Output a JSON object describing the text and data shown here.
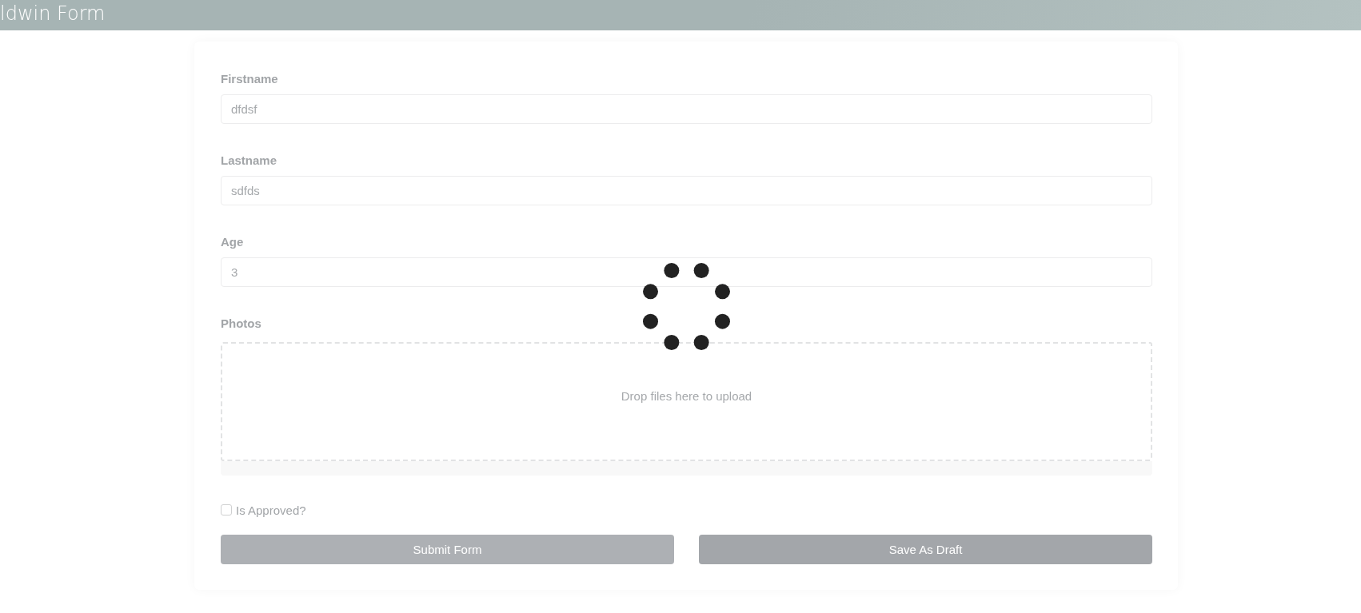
{
  "header": {
    "title": "ldwin Form"
  },
  "form": {
    "fields": [
      {
        "label": "Firstname",
        "value": "dfdsf"
      },
      {
        "label": "Lastname",
        "value": "sdfds"
      },
      {
        "label": "Age",
        "value": "3"
      }
    ],
    "photos": {
      "label": "Photos",
      "dropzone_text": "Drop files here to upload"
    },
    "approved": {
      "label": "Is Approved?",
      "checked": false
    },
    "buttons": [
      {
        "kind": "primary",
        "label": "Submit Form"
      },
      {
        "kind": "secondary",
        "label": "Save As Draft"
      }
    ]
  },
  "loading": true
}
